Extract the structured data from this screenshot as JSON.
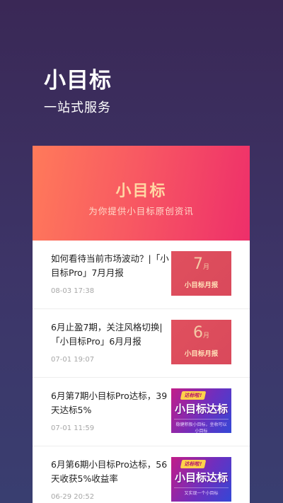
{
  "hero": {
    "title": "小目标",
    "subtitle": "一站式服务"
  },
  "banner": {
    "title": "小目标",
    "subtitle": "为你提供小目标原创资讯"
  },
  "articles": [
    {
      "title": "如何看待当前市场波动？|「小目标Pro」7月月报",
      "date": "08-03 17:38",
      "thumb": {
        "type": "monthly",
        "number": "7",
        "unit": "月",
        "label": "小目标月报"
      }
    },
    {
      "title": "6月止盈7期，关注风格切换|「小目标Pro」6月月报",
      "date": "07-01 19:07",
      "thumb": {
        "type": "monthly",
        "number": "6",
        "unit": "月",
        "label": "小目标月报"
      }
    },
    {
      "title": "6月第7期小目标Pro达标，39天达标5%",
      "date": "07-01 11:59",
      "thumb": {
        "type": "promo",
        "tag": "达标啦!",
        "main": "小目标达标",
        "sub": "稳健积极小目标，坐收可以小目标"
      }
    },
    {
      "title": "6月第6期小目标Pro达标，56天收获5%收益率",
      "date": "06-29 20:52",
      "thumb": {
        "type": "promo",
        "tag": "达标啦!",
        "main": "小目标达标",
        "sub": "又实现一个小目标"
      }
    }
  ],
  "colors": {
    "background_top": "#3a2856",
    "background_bottom": "#393e70",
    "banner_start": "#ff7a5a",
    "banner_end": "#ee2f6a",
    "banner_text": "#ffd7a3",
    "monthly_thumb": "#e0505e",
    "promo_start": "#c21d88",
    "promo_end": "#3347d6"
  }
}
